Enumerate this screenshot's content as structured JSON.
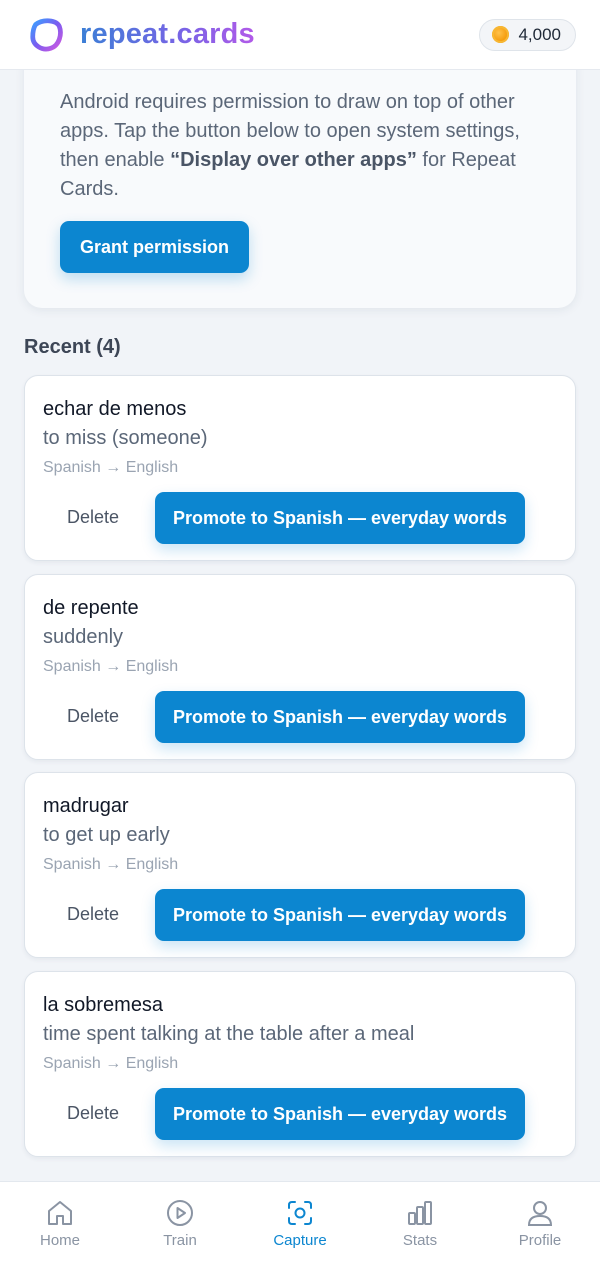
{
  "header": {
    "brand": "repeat.cards",
    "coins": "4,000",
    "logo_icon": "repeat-cards-logo",
    "coin_icon": "coin-icon"
  },
  "permission": {
    "text_before": "Android requires permission to draw on top of other apps. Tap the button below to open system settings, then enable ",
    "text_emphasis": "“Display over other apps”",
    "text_after": " for Repeat Cards.",
    "button_label": "Grant permission"
  },
  "recent": {
    "title": "Recent (4)",
    "items": [
      {
        "term": "echar de menos",
        "translation": "to miss (someone)",
        "languages": "Spanish → English",
        "delete_label": "Delete",
        "promote_label": "Promote to Spanish — everyday words"
      },
      {
        "term": "de repente",
        "translation": "suddenly",
        "languages": "Spanish → English",
        "delete_label": "Delete",
        "promote_label": "Promote to Spanish — everyday words"
      },
      {
        "term": "madrugar",
        "translation": "to get up early",
        "languages": "Spanish → English",
        "delete_label": "Delete",
        "promote_label": "Promote to Spanish — everyday words"
      },
      {
        "term": "la sobremesa",
        "translation": "time spent talking at the table after a meal",
        "languages": "Spanish → English",
        "delete_label": "Delete",
        "promote_label": "Promote to Spanish — everyday words"
      }
    ]
  },
  "nav": {
    "items": [
      {
        "label": "Home",
        "icon": "home-icon",
        "active": false
      },
      {
        "label": "Train",
        "icon": "play-circle-icon",
        "active": false
      },
      {
        "label": "Capture",
        "icon": "capture-icon",
        "active": true
      },
      {
        "label": "Stats",
        "icon": "stats-icon",
        "active": false
      },
      {
        "label": "Profile",
        "icon": "profile-icon",
        "active": false
      }
    ]
  },
  "colors": {
    "accent": "#0c86d0",
    "background": "#f1f4f8",
    "nav_inactive": "#8a94a3"
  }
}
